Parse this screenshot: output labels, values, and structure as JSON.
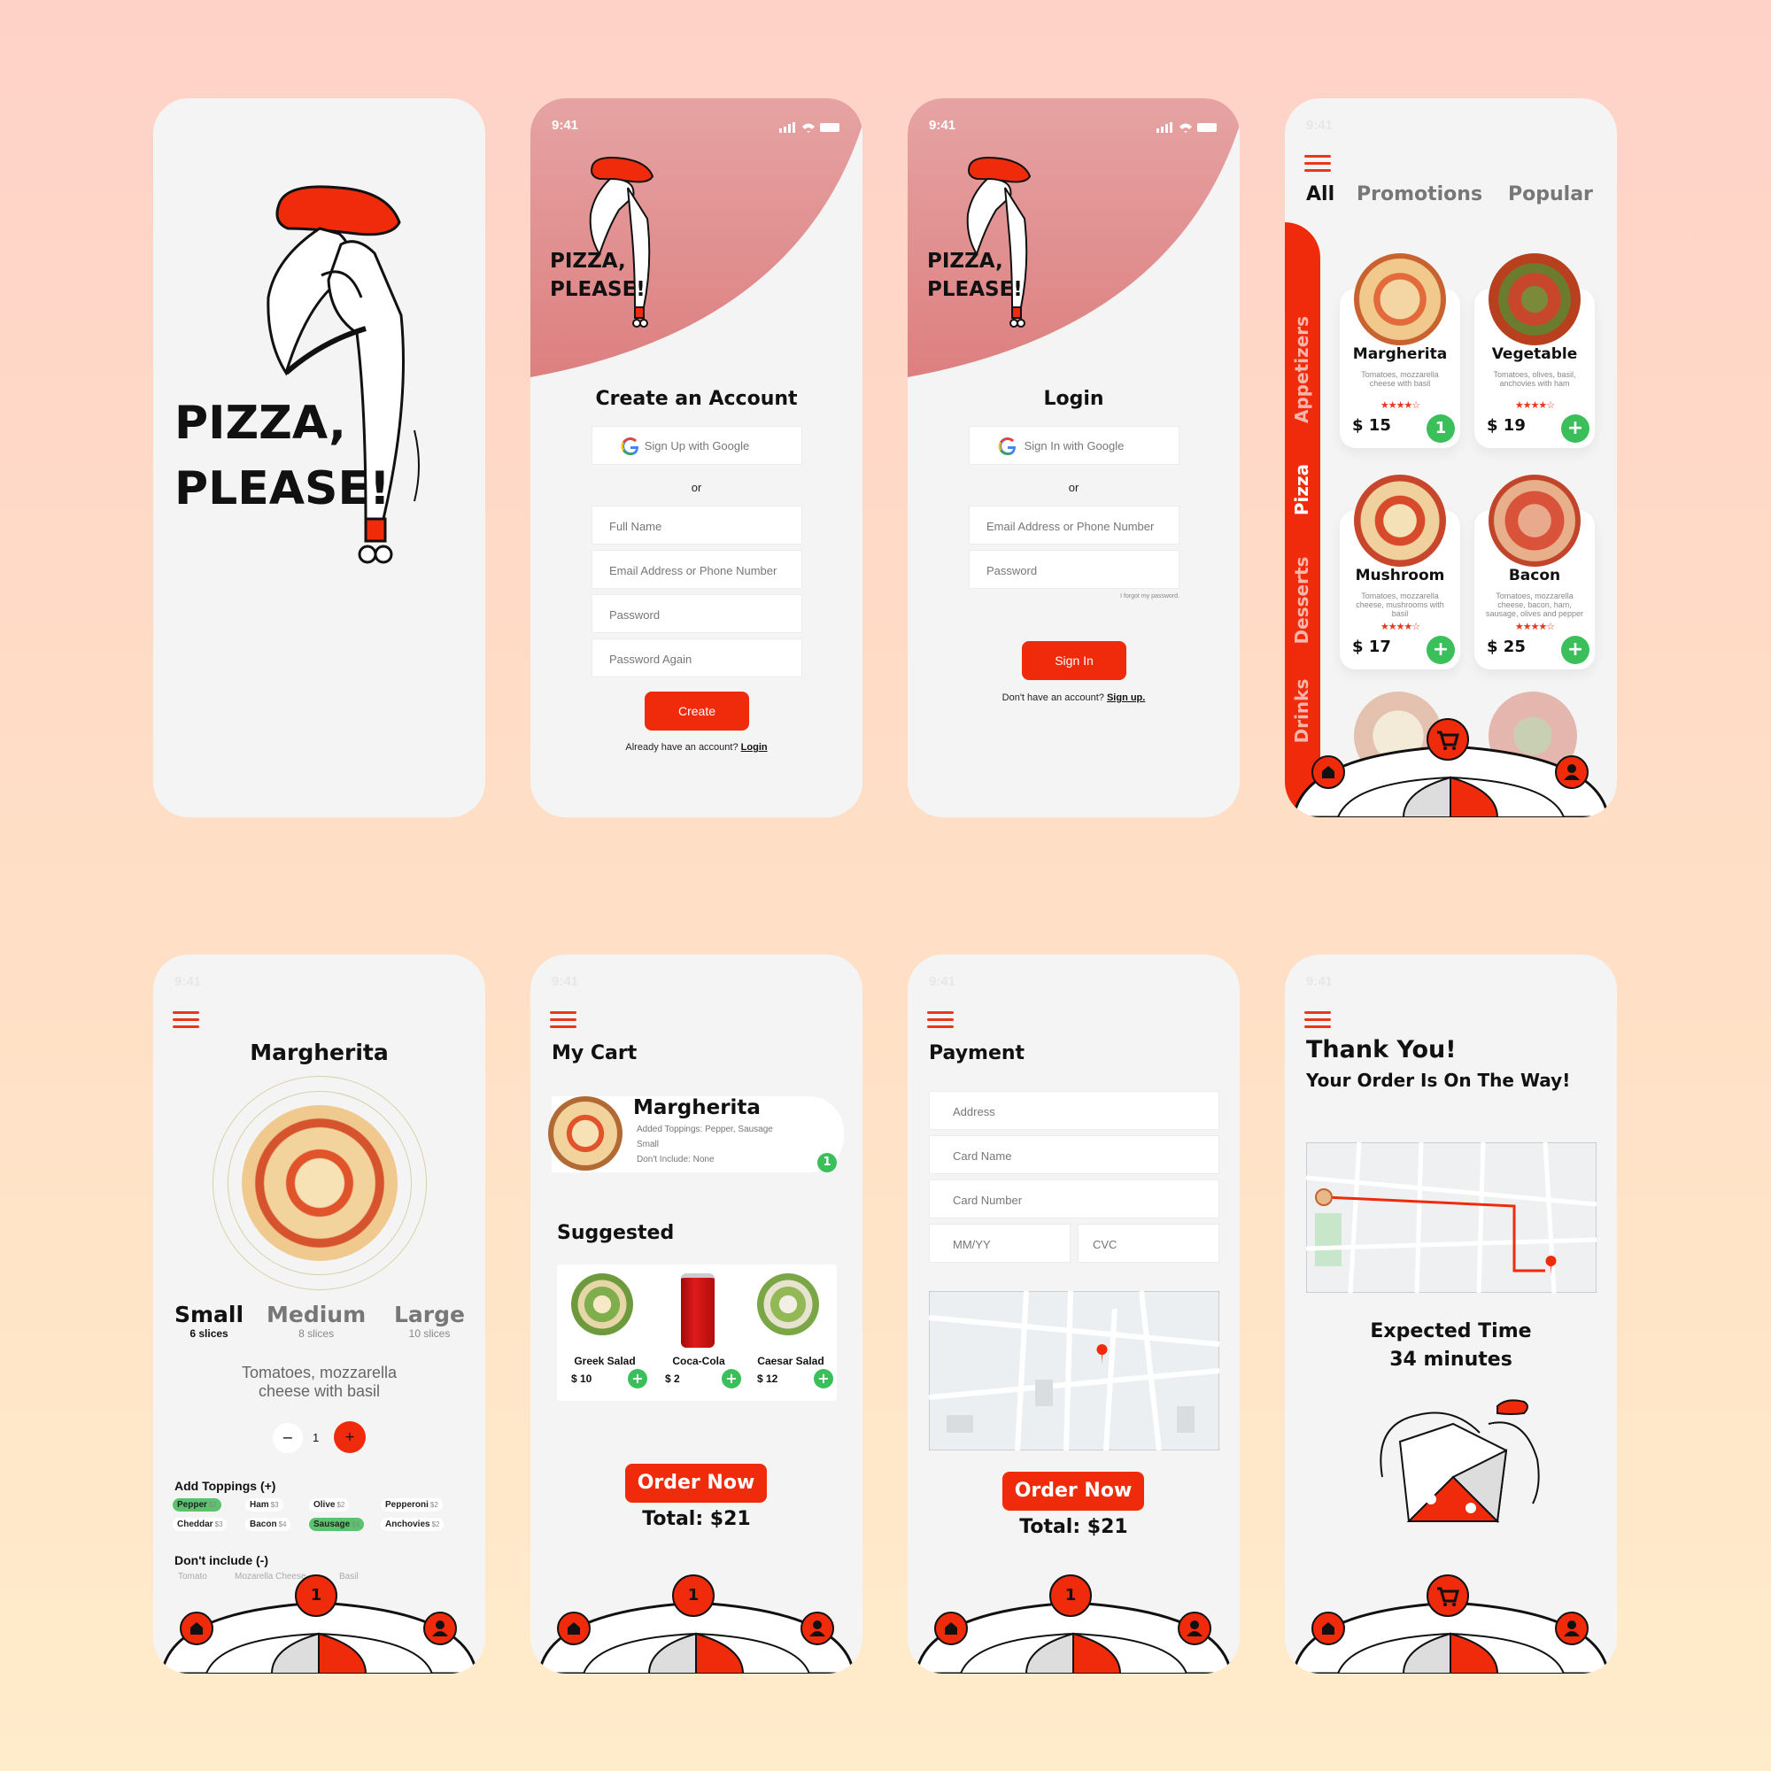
{
  "status_time": "9:41",
  "splash": {
    "title_line1": "PIZZA,",
    "title_line2": "PLEASE!"
  },
  "brand": {
    "line1": "PIZZA,",
    "line2": "PLEASE!"
  },
  "signup": {
    "title": "Create an Account",
    "google_label": "Sign Up with Google",
    "or": "or",
    "fields": [
      "Full Name",
      "Email Address or Phone Number",
      "Password",
      "Password Again"
    ],
    "create_label": "Create",
    "footer_text": "Already have an account?",
    "footer_link": "Login"
  },
  "login": {
    "title": "Login",
    "google_label": "Sign In with Google",
    "or": "or",
    "fields": [
      "Email Address or Phone Number",
      "Password"
    ],
    "forgot": "I forgot my password.",
    "signin_label": "Sign In",
    "footer_text": "Don't have an account?",
    "footer_link": "Sign up."
  },
  "menu": {
    "tabs": [
      "All",
      "Promotions",
      "Popular"
    ],
    "categories": [
      "Appetizers",
      "Pizza",
      "Desserts",
      "Drinks"
    ],
    "items": [
      {
        "name": "Margherita",
        "desc": "Tomatoes, mozzarella cheese with basil",
        "stars": "★★★★☆",
        "price": "$ 15",
        "badge": "1"
      },
      {
        "name": "Vegetable",
        "desc": "Tomatoes, olives, basil, anchovies with ham",
        "stars": "★★★★☆",
        "price": "$ 19",
        "badge": "+"
      },
      {
        "name": "Mushroom",
        "desc": "Tomatoes, mozzarella cheese, mushrooms with basil",
        "stars": "★★★★☆",
        "price": "$ 17",
        "badge": "+"
      },
      {
        "name": "Bacon",
        "desc": "Tomatoes, mozzarella cheese, bacon, ham, sausage, olives and pepper",
        "stars": "★★★★☆",
        "price": "$ 25",
        "badge": "+"
      }
    ]
  },
  "detail": {
    "title": "Margherita",
    "sizes": [
      {
        "label": "Small",
        "sub": "6 slices"
      },
      {
        "label": "Medium",
        "sub": "8 slices"
      },
      {
        "label": "Large",
        "sub": "10 slices"
      }
    ],
    "desc_line1": "Tomatoes, mozzarella",
    "desc_line2": "cheese with basil",
    "qty_minus": "−",
    "qty": "1",
    "qty_plus": "+",
    "toppings_title": "Add Toppings (+)",
    "toppings": [
      {
        "name": "Pepper",
        "price": "$2",
        "selected": true
      },
      {
        "name": "Ham",
        "price": "$3",
        "selected": false
      },
      {
        "name": "Olive",
        "price": "$2",
        "selected": false
      },
      {
        "name": "Pepperoni",
        "price": "$2",
        "selected": false
      },
      {
        "name": "Cheddar",
        "price": "$3",
        "selected": false
      },
      {
        "name": "Bacon",
        "price": "$4",
        "selected": false
      },
      {
        "name": "Sausage",
        "price": "$4",
        "selected": true
      },
      {
        "name": "Anchovies",
        "price": "$2",
        "selected": false
      }
    ],
    "exclude_title": "Don't include (-)",
    "exclude": [
      "Tomato",
      "Mozarella Cheese",
      "Basil"
    ]
  },
  "cart": {
    "title": "My Cart",
    "item_name": "Margherita",
    "item_toppings": "Added Toppings: Pepper, Sausage",
    "item_size": "Small",
    "item_exclude": "Don't Include: None",
    "item_qty": "1",
    "suggested_title": "Suggested",
    "suggested": [
      {
        "name": "Greek Salad",
        "price": "$ 10"
      },
      {
        "name": "Coca-Cola",
        "price": "$ 2"
      },
      {
        "name": "Caesar Salad",
        "price": "$ 12"
      }
    ],
    "order_label": "Order Now",
    "total": "Total: $21"
  },
  "payment": {
    "title": "Payment",
    "fields": [
      "Address",
      "Card Name",
      "Card Number"
    ],
    "mmyy": "MM/YY",
    "cvc": "CVC",
    "order_label": "Order Now",
    "total": "Total: $21"
  },
  "thanks": {
    "title": "Thank You!",
    "subtitle": "Your Order Is On The Way!",
    "expected_label": "Expected Time",
    "expected_value": "34 minutes"
  },
  "nav": {
    "cart_count": "1"
  },
  "colors": {
    "accent": "#f02b0c",
    "green": "#3bbf5b",
    "hero": "#df8384"
  }
}
